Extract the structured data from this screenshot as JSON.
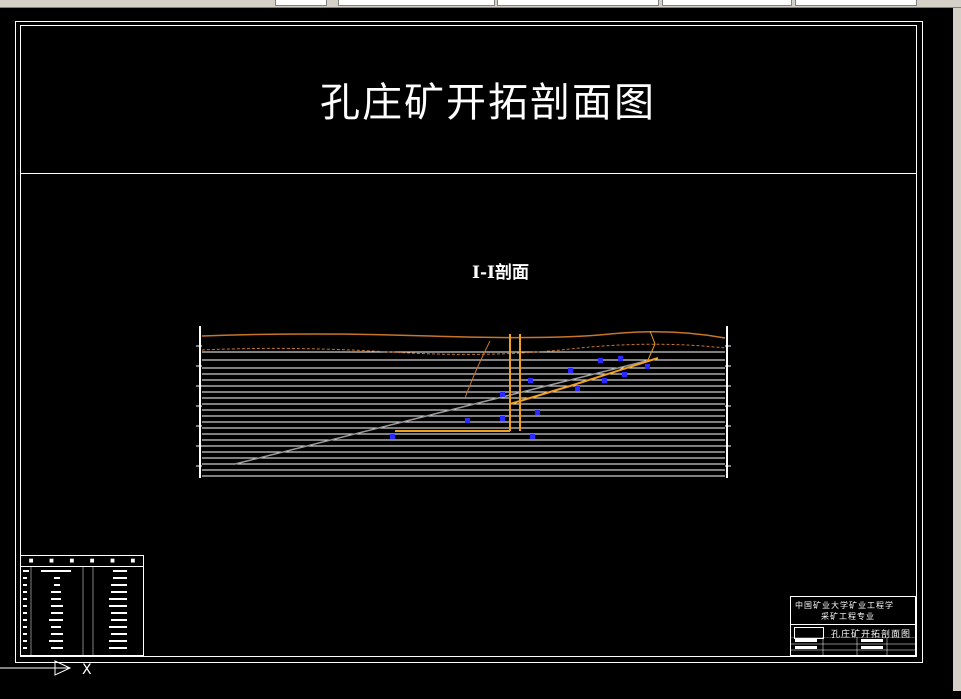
{
  "drawing": {
    "title": "孔庄矿开拓剖面图",
    "section_label": "I-I剖面"
  },
  "title_block": {
    "school": "中国矿业大学矿业工程学",
    "major": "采矿工程专业",
    "drawing_name": "孔庄矿开拓剖面图"
  },
  "colors": {
    "background": "#000000",
    "frame": "#ffffff",
    "strata_lines": "#ffffff",
    "topsoil": "#c8742a",
    "roadway": "#f0a020",
    "shaft": "#f0a020",
    "markers": "#2a2aff",
    "seam": "#9a9a9a"
  },
  "ucs": {
    "x_label": "X"
  }
}
